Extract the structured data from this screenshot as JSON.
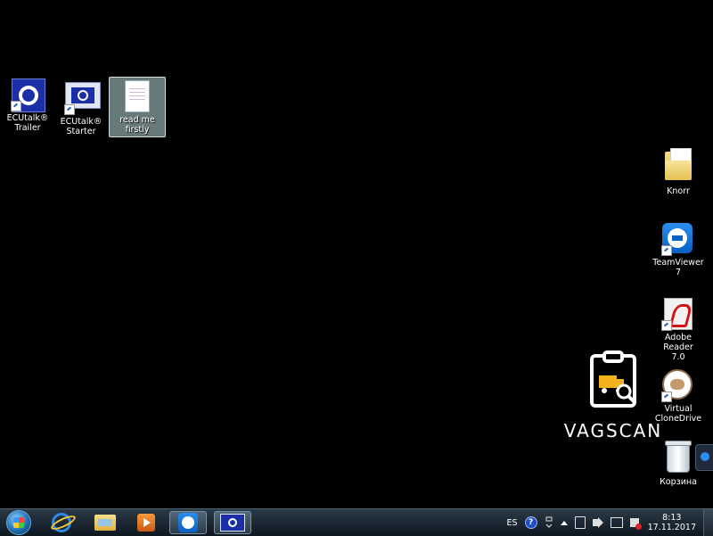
{
  "desktop": {
    "left_icons": [
      {
        "label": "ECUtalk®\nTrailer"
      },
      {
        "label": "ECUtalk®\nStarter"
      },
      {
        "label": "read me\nfirstly"
      }
    ],
    "right_icons": [
      {
        "label": "Knorr"
      },
      {
        "label": "TeamViewer 7"
      },
      {
        "label": "Adobe Reader\n7.0"
      },
      {
        "label": "Virtual\nCloneDrive"
      },
      {
        "label": "Корзина"
      }
    ]
  },
  "watermark": {
    "text": "VAGSCAN"
  },
  "taskbar": {
    "language": "ES",
    "help_glyph": "?",
    "clock": {
      "time": "8:13",
      "date": "17.11.2017"
    }
  }
}
